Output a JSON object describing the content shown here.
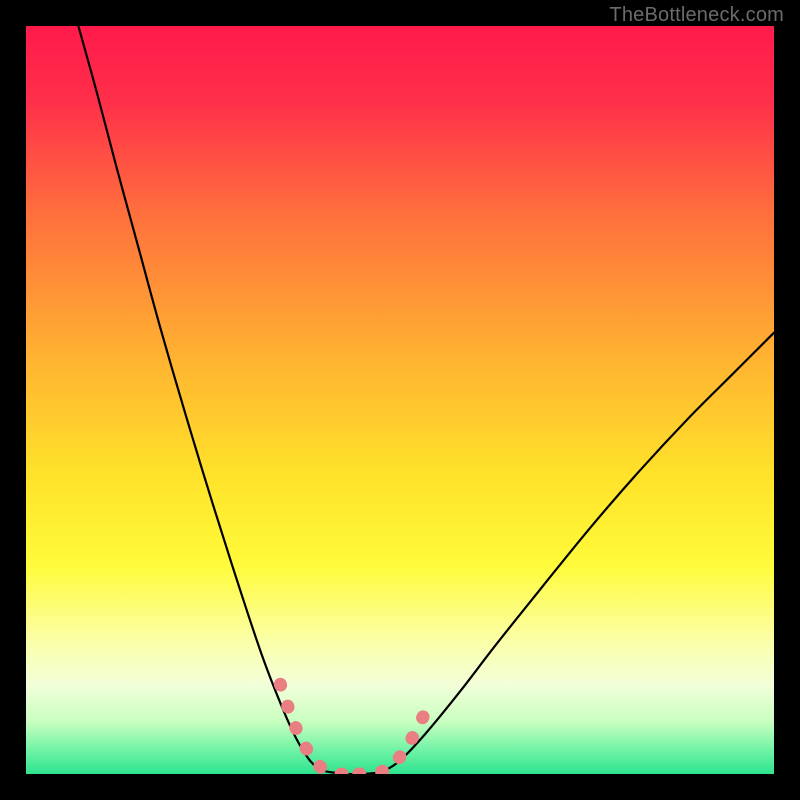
{
  "watermark": {
    "text": "TheBottleneck.com"
  },
  "chart_data": {
    "type": "line",
    "title": "",
    "xlabel": "",
    "ylabel": "",
    "xlim": [
      0,
      100
    ],
    "ylim": [
      0,
      100
    ],
    "grid": false,
    "legend": false,
    "gradient_stops": [
      {
        "offset": 0.0,
        "color": "#ff1a4b"
      },
      {
        "offset": 0.1,
        "color": "#ff2f4a"
      },
      {
        "offset": 0.25,
        "color": "#ff6f3d"
      },
      {
        "offset": 0.45,
        "color": "#ffb531"
      },
      {
        "offset": 0.6,
        "color": "#ffe22a"
      },
      {
        "offset": 0.72,
        "color": "#fffb3a"
      },
      {
        "offset": 0.82,
        "color": "#fbffa6"
      },
      {
        "offset": 0.88,
        "color": "#f3ffd9"
      },
      {
        "offset": 0.93,
        "color": "#c9ffc0"
      },
      {
        "offset": 0.97,
        "color": "#6cf2a4"
      },
      {
        "offset": 1.0,
        "color": "#2de38f"
      }
    ],
    "series": [
      {
        "name": "left-curve",
        "x": [
          7.0,
          9.5,
          12.0,
          15.0,
          18.0,
          21.5,
          25.0,
          28.5,
          31.5,
          34.0,
          36.0,
          37.8,
          39.3
        ],
        "y": [
          100.0,
          91.0,
          81.5,
          70.5,
          59.5,
          47.5,
          36.0,
          25.0,
          16.0,
          9.5,
          5.0,
          2.0,
          0.5
        ]
      },
      {
        "name": "valley-flat",
        "x": [
          39.3,
          41.0,
          43.0,
          45.0,
          47.5
        ],
        "y": [
          0.5,
          0.2,
          0.0,
          0.0,
          0.2
        ]
      },
      {
        "name": "right-curve",
        "x": [
          47.5,
          50.0,
          53.5,
          58.0,
          63.0,
          69.0,
          75.5,
          82.0,
          88.5,
          94.5,
          100.0
        ],
        "y": [
          0.2,
          1.8,
          5.5,
          11.0,
          17.5,
          25.0,
          33.0,
          40.5,
          47.5,
          53.5,
          59.0
        ]
      },
      {
        "name": "pink-highlight-left",
        "x": [
          34.0,
          35.3,
          36.6,
          38.0,
          39.3,
          40.5,
          42.0,
          43.5
        ],
        "y": [
          12.0,
          8.2,
          5.0,
          2.6,
          1.0,
          0.3,
          0.0,
          0.0
        ]
      },
      {
        "name": "pink-highlight-right",
        "x": [
          44.5,
          46.0,
          47.5,
          49.0,
          50.5,
          52.0,
          53.5
        ],
        "y": [
          0.0,
          0.0,
          0.3,
          1.2,
          3.0,
          5.5,
          8.5
        ]
      }
    ],
    "annotations": []
  }
}
